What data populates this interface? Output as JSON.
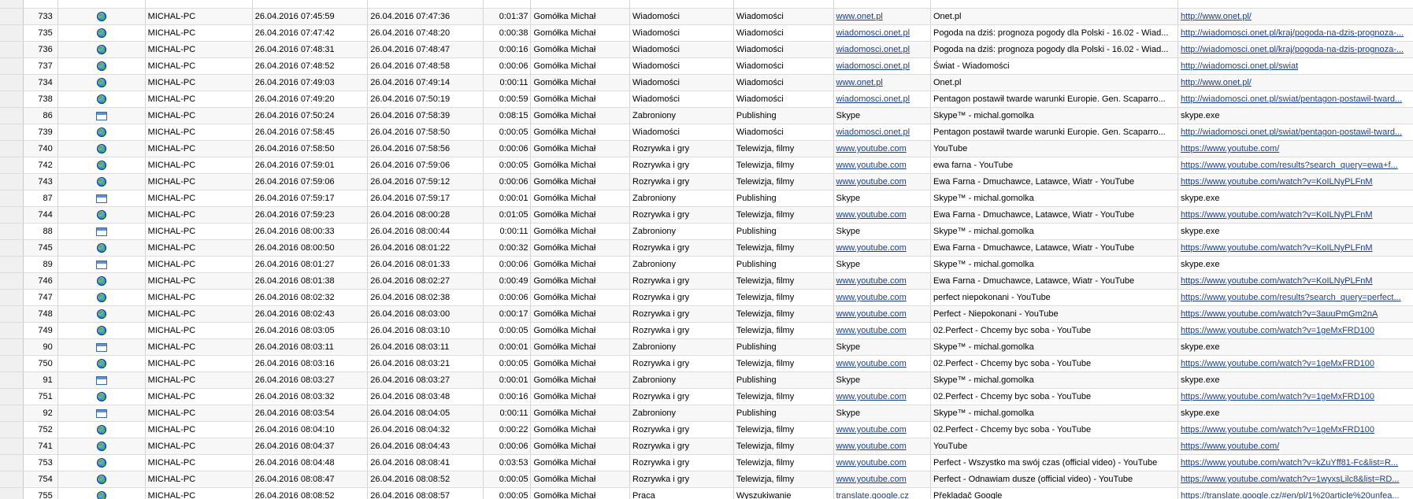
{
  "rows": [
    {
      "id": "733",
      "icon": "globe",
      "computer": "MICHAL-PC",
      "start": "26.04.2016 07:45:59",
      "end": "26.04.2016 07:47:36",
      "duration": "0:01:37",
      "user": "Gomółka Michał",
      "category": "Wiadomości",
      "subcategory": "Wiadomości",
      "site": "www.onet.pl",
      "site_link": true,
      "title": "Onet.pl",
      "url": "http://www.onet.pl/",
      "url_link": true
    },
    {
      "id": "735",
      "icon": "globe",
      "computer": "MICHAL-PC",
      "start": "26.04.2016 07:47:42",
      "end": "26.04.2016 07:48:20",
      "duration": "0:00:38",
      "user": "Gomółka Michał",
      "category": "Wiadomości",
      "subcategory": "Wiadomości",
      "site": "wiadomosci.onet.pl",
      "site_link": true,
      "title": "Pogoda na dziś: prognoza pogody dla Polski - 16.02 - Wiad...",
      "url": "http://wiadomosci.onet.pl/kraj/pogoda-na-dzis-prognoza-...",
      "url_link": true
    },
    {
      "id": "736",
      "icon": "globe",
      "computer": "MICHAL-PC",
      "start": "26.04.2016 07:48:31",
      "end": "26.04.2016 07:48:47",
      "duration": "0:00:16",
      "user": "Gomółka Michał",
      "category": "Wiadomości",
      "subcategory": "Wiadomości",
      "site": "wiadomosci.onet.pl",
      "site_link": true,
      "title": "Pogoda na dziś: prognoza pogody dla Polski - 16.02 - Wiad...",
      "url": "http://wiadomosci.onet.pl/kraj/pogoda-na-dzis-prognoza-...",
      "url_link": true
    },
    {
      "id": "737",
      "icon": "globe",
      "computer": "MICHAL-PC",
      "start": "26.04.2016 07:48:52",
      "end": "26.04.2016 07:48:58",
      "duration": "0:00:06",
      "user": "Gomółka Michał",
      "category": "Wiadomości",
      "subcategory": "Wiadomości",
      "site": "wiadomosci.onet.pl",
      "site_link": true,
      "title": "Świat - Wiadomości",
      "url": "http://wiadomosci.onet.pl/swiat",
      "url_link": true
    },
    {
      "id": "734",
      "icon": "globe",
      "computer": "MICHAL-PC",
      "start": "26.04.2016 07:49:03",
      "end": "26.04.2016 07:49:14",
      "duration": "0:00:11",
      "user": "Gomółka Michał",
      "category": "Wiadomości",
      "subcategory": "Wiadomości",
      "site": "www.onet.pl",
      "site_link": true,
      "title": "Onet.pl",
      "url": "http://www.onet.pl/",
      "url_link": true
    },
    {
      "id": "738",
      "icon": "globe",
      "computer": "MICHAL-PC",
      "start": "26.04.2016 07:49:20",
      "end": "26.04.2016 07:50:19",
      "duration": "0:00:59",
      "user": "Gomółka Michał",
      "category": "Wiadomości",
      "subcategory": "Wiadomości",
      "site": "wiadomosci.onet.pl",
      "site_link": true,
      "title": "Pentagon postawił twarde warunki Europie. Gen. Scaparro...",
      "url": "http://wiadomosci.onet.pl/swiat/pentagon-postawil-tward...",
      "url_link": true
    },
    {
      "id": "86",
      "icon": "window",
      "computer": "MICHAL-PC",
      "start": "26.04.2016 07:50:24",
      "end": "26.04.2016 07:58:39",
      "duration": "0:08:15",
      "user": "Gomółka Michał",
      "category": "Zabroniony",
      "subcategory": "Publishing",
      "site": "Skype",
      "site_link": false,
      "title": "Skype™ - michal.gomolka",
      "url": "skype.exe",
      "url_link": false
    },
    {
      "id": "739",
      "icon": "globe",
      "computer": "MICHAL-PC",
      "start": "26.04.2016 07:58:45",
      "end": "26.04.2016 07:58:50",
      "duration": "0:00:05",
      "user": "Gomółka Michał",
      "category": "Wiadomości",
      "subcategory": "Wiadomości",
      "site": "wiadomosci.onet.pl",
      "site_link": true,
      "title": "Pentagon postawił twarde warunki Europie. Gen. Scaparro...",
      "url": "http://wiadomosci.onet.pl/swiat/pentagon-postawil-tward...",
      "url_link": true
    },
    {
      "id": "740",
      "icon": "globe",
      "computer": "MICHAL-PC",
      "start": "26.04.2016 07:58:50",
      "end": "26.04.2016 07:58:56",
      "duration": "0:00:06",
      "user": "Gomółka Michał",
      "category": "Rozrywka i gry",
      "subcategory": "Telewizja, filmy",
      "site": "www.youtube.com",
      "site_link": true,
      "title": "YouTube",
      "url": "https://www.youtube.com/",
      "url_link": true
    },
    {
      "id": "742",
      "icon": "globe",
      "computer": "MICHAL-PC",
      "start": "26.04.2016 07:59:01",
      "end": "26.04.2016 07:59:06",
      "duration": "0:00:05",
      "user": "Gomółka Michał",
      "category": "Rozrywka i gry",
      "subcategory": "Telewizja, filmy",
      "site": "www.youtube.com",
      "site_link": true,
      "title": "ewa farna - YouTube",
      "url": "https://www.youtube.com/results?search_query=ewa+f...",
      "url_link": true
    },
    {
      "id": "743",
      "icon": "globe",
      "computer": "MICHAL-PC",
      "start": "26.04.2016 07:59:06",
      "end": "26.04.2016 07:59:12",
      "duration": "0:00:06",
      "user": "Gomółka Michał",
      "category": "Rozrywka i gry",
      "subcategory": "Telewizja, filmy",
      "site": "www.youtube.com",
      "site_link": true,
      "title": "Ewa Farna - Dmuchawce, Latawce, Wiatr - YouTube",
      "url": "https://www.youtube.com/watch?v=KoILNyPLFnM",
      "url_link": true
    },
    {
      "id": "87",
      "icon": "window",
      "computer": "MICHAL-PC",
      "start": "26.04.2016 07:59:17",
      "end": "26.04.2016 07:59:17",
      "duration": "0:00:01",
      "user": "Gomółka Michał",
      "category": "Zabroniony",
      "subcategory": "Publishing",
      "site": "Skype",
      "site_link": false,
      "title": "Skype™ - michal.gomolka",
      "url": "skype.exe",
      "url_link": false
    },
    {
      "id": "744",
      "icon": "globe",
      "computer": "MICHAL-PC",
      "start": "26.04.2016 07:59:23",
      "end": "26.04.2016 08:00:28",
      "duration": "0:01:05",
      "user": "Gomółka Michał",
      "category": "Rozrywka i gry",
      "subcategory": "Telewizja, filmy",
      "site": "www.youtube.com",
      "site_link": true,
      "title": "Ewa Farna - Dmuchawce, Latawce, Wiatr - YouTube",
      "url": "https://www.youtube.com/watch?v=KoILNyPLFnM",
      "url_link": true
    },
    {
      "id": "88",
      "icon": "window",
      "computer": "MICHAL-PC",
      "start": "26.04.2016 08:00:33",
      "end": "26.04.2016 08:00:44",
      "duration": "0:00:11",
      "user": "Gomółka Michał",
      "category": "Zabroniony",
      "subcategory": "Publishing",
      "site": "Skype",
      "site_link": false,
      "title": "Skype™ - michal.gomolka",
      "url": "skype.exe",
      "url_link": false
    },
    {
      "id": "745",
      "icon": "globe",
      "computer": "MICHAL-PC",
      "start": "26.04.2016 08:00:50",
      "end": "26.04.2016 08:01:22",
      "duration": "0:00:32",
      "user": "Gomółka Michał",
      "category": "Rozrywka i gry",
      "subcategory": "Telewizja, filmy",
      "site": "www.youtube.com",
      "site_link": true,
      "title": "Ewa Farna - Dmuchawce, Latawce, Wiatr - YouTube",
      "url": "https://www.youtube.com/watch?v=KoILNyPLFnM",
      "url_link": true
    },
    {
      "id": "89",
      "icon": "window",
      "computer": "MICHAL-PC",
      "start": "26.04.2016 08:01:27",
      "end": "26.04.2016 08:01:33",
      "duration": "0:00:06",
      "user": "Gomółka Michał",
      "category": "Zabroniony",
      "subcategory": "Publishing",
      "site": "Skype",
      "site_link": false,
      "title": "Skype™ - michal.gomolka",
      "url": "skype.exe",
      "url_link": false
    },
    {
      "id": "746",
      "icon": "globe",
      "computer": "MICHAL-PC",
      "start": "26.04.2016 08:01:38",
      "end": "26.04.2016 08:02:27",
      "duration": "0:00:49",
      "user": "Gomółka Michał",
      "category": "Rozrywka i gry",
      "subcategory": "Telewizja, filmy",
      "site": "www.youtube.com",
      "site_link": true,
      "title": "Ewa Farna - Dmuchawce, Latawce, Wiatr - YouTube",
      "url": "https://www.youtube.com/watch?v=KoILNyPLFnM",
      "url_link": true
    },
    {
      "id": "747",
      "icon": "globe",
      "computer": "MICHAL-PC",
      "start": "26.04.2016 08:02:32",
      "end": "26.04.2016 08:02:38",
      "duration": "0:00:06",
      "user": "Gomółka Michał",
      "category": "Rozrywka i gry",
      "subcategory": "Telewizja, filmy",
      "site": "www.youtube.com",
      "site_link": true,
      "title": "perfect niepokonani - YouTube",
      "url": "https://www.youtube.com/results?search_query=perfect...",
      "url_link": true
    },
    {
      "id": "748",
      "icon": "globe",
      "computer": "MICHAL-PC",
      "start": "26.04.2016 08:02:43",
      "end": "26.04.2016 08:03:00",
      "duration": "0:00:17",
      "user": "Gomółka Michał",
      "category": "Rozrywka i gry",
      "subcategory": "Telewizja, filmy",
      "site": "www.youtube.com",
      "site_link": true,
      "title": "Perfect - Niepokonani - YouTube",
      "url": "https://www.youtube.com/watch?v=3auuPmGm2nA",
      "url_link": true
    },
    {
      "id": "749",
      "icon": "globe",
      "computer": "MICHAL-PC",
      "start": "26.04.2016 08:03:05",
      "end": "26.04.2016 08:03:10",
      "duration": "0:00:05",
      "user": "Gomółka Michał",
      "category": "Rozrywka i gry",
      "subcategory": "Telewizja, filmy",
      "site": "www.youtube.com",
      "site_link": true,
      "title": "02.Perfect - Chcemy byc soba - YouTube",
      "url": "https://www.youtube.com/watch?v=1geMxFRD100",
      "url_link": true
    },
    {
      "id": "90",
      "icon": "window",
      "computer": "MICHAL-PC",
      "start": "26.04.2016 08:03:11",
      "end": "26.04.2016 08:03:11",
      "duration": "0:00:01",
      "user": "Gomółka Michał",
      "category": "Zabroniony",
      "subcategory": "Publishing",
      "site": "Skype",
      "site_link": false,
      "title": "Skype™ - michal.gomolka",
      "url": "skype.exe",
      "url_link": false
    },
    {
      "id": "750",
      "icon": "globe",
      "computer": "MICHAL-PC",
      "start": "26.04.2016 08:03:16",
      "end": "26.04.2016 08:03:21",
      "duration": "0:00:05",
      "user": "Gomółka Michał",
      "category": "Rozrywka i gry",
      "subcategory": "Telewizja, filmy",
      "site": "www.youtube.com",
      "site_link": true,
      "title": "02.Perfect - Chcemy byc soba - YouTube",
      "url": "https://www.youtube.com/watch?v=1geMxFRD100",
      "url_link": true
    },
    {
      "id": "91",
      "icon": "window",
      "computer": "MICHAL-PC",
      "start": "26.04.2016 08:03:27",
      "end": "26.04.2016 08:03:27",
      "duration": "0:00:01",
      "user": "Gomółka Michał",
      "category": "Zabroniony",
      "subcategory": "Publishing",
      "site": "Skype",
      "site_link": false,
      "title": "Skype™ - michal.gomolka",
      "url": "skype.exe",
      "url_link": false
    },
    {
      "id": "751",
      "icon": "globe",
      "computer": "MICHAL-PC",
      "start": "26.04.2016 08:03:32",
      "end": "26.04.2016 08:03:48",
      "duration": "0:00:16",
      "user": "Gomółka Michał",
      "category": "Rozrywka i gry",
      "subcategory": "Telewizja, filmy",
      "site": "www.youtube.com",
      "site_link": true,
      "title": "02.Perfect - Chcemy byc soba - YouTube",
      "url": "https://www.youtube.com/watch?v=1geMxFRD100",
      "url_link": true
    },
    {
      "id": "92",
      "icon": "window",
      "computer": "MICHAL-PC",
      "start": "26.04.2016 08:03:54",
      "end": "26.04.2016 08:04:05",
      "duration": "0:00:11",
      "user": "Gomółka Michał",
      "category": "Zabroniony",
      "subcategory": "Publishing",
      "site": "Skype",
      "site_link": false,
      "title": "Skype™ - michal.gomolka",
      "url": "skype.exe",
      "url_link": false
    },
    {
      "id": "752",
      "icon": "globe",
      "computer": "MICHAL-PC",
      "start": "26.04.2016 08:04:10",
      "end": "26.04.2016 08:04:32",
      "duration": "0:00:22",
      "user": "Gomółka Michał",
      "category": "Rozrywka i gry",
      "subcategory": "Telewizja, filmy",
      "site": "www.youtube.com",
      "site_link": true,
      "title": "02.Perfect - Chcemy byc soba - YouTube",
      "url": "https://www.youtube.com/watch?v=1geMxFRD100",
      "url_link": true
    },
    {
      "id": "741",
      "icon": "globe",
      "computer": "MICHAL-PC",
      "start": "26.04.2016 08:04:37",
      "end": "26.04.2016 08:04:43",
      "duration": "0:00:06",
      "user": "Gomółka Michał",
      "category": "Rozrywka i gry",
      "subcategory": "Telewizja, filmy",
      "site": "www.youtube.com",
      "site_link": true,
      "title": "YouTube",
      "url": "https://www.youtube.com/",
      "url_link": true
    },
    {
      "id": "753",
      "icon": "globe",
      "computer": "MICHAL-PC",
      "start": "26.04.2016 08:04:48",
      "end": "26.04.2016 08:08:41",
      "duration": "0:03:53",
      "user": "Gomółka Michał",
      "category": "Rozrywka i gry",
      "subcategory": "Telewizja, filmy",
      "site": "www.youtube.com",
      "site_link": true,
      "title": "Perfect - Wszystko ma swój czas (official video) - YouTube",
      "url": "https://www.youtube.com/watch?v=kZuYff81-Fc&list=R...",
      "url_link": true
    },
    {
      "id": "754",
      "icon": "globe",
      "computer": "MICHAL-PC",
      "start": "26.04.2016 08:08:47",
      "end": "26.04.2016 08:08:52",
      "duration": "0:00:05",
      "user": "Gomółka Michał",
      "category": "Rozrywka i gry",
      "subcategory": "Telewizja, filmy",
      "site": "www.youtube.com",
      "site_link": true,
      "title": "Perfect - Odnawiam dusze (official video) - YouTube",
      "url": "https://www.youtube.com/watch?v=1wyxsLilc8&list=RD...",
      "url_link": true
    },
    {
      "id": "755",
      "icon": "globe",
      "computer": "MICHAL-PC",
      "start": "26.04.2016 08:08:52",
      "end": "26.04.2016 08:08:57",
      "duration": "0:00:05",
      "user": "Gomółka Michał",
      "category": "Praca",
      "subcategory": "Wyszukiwanie",
      "site": "translate.google.cz",
      "site_link": true,
      "title": "Překladač Google",
      "url": "https://translate.google.cz/#en/pl/1%20article%20unfea...",
      "url_link": true
    }
  ],
  "icons": {
    "globe": "internet-globe-icon",
    "window": "application-window-icon"
  },
  "colors": {
    "link": "#1b3f8f",
    "row_alt": "#f7f7f7",
    "grid_line": "#d4d4d4"
  }
}
